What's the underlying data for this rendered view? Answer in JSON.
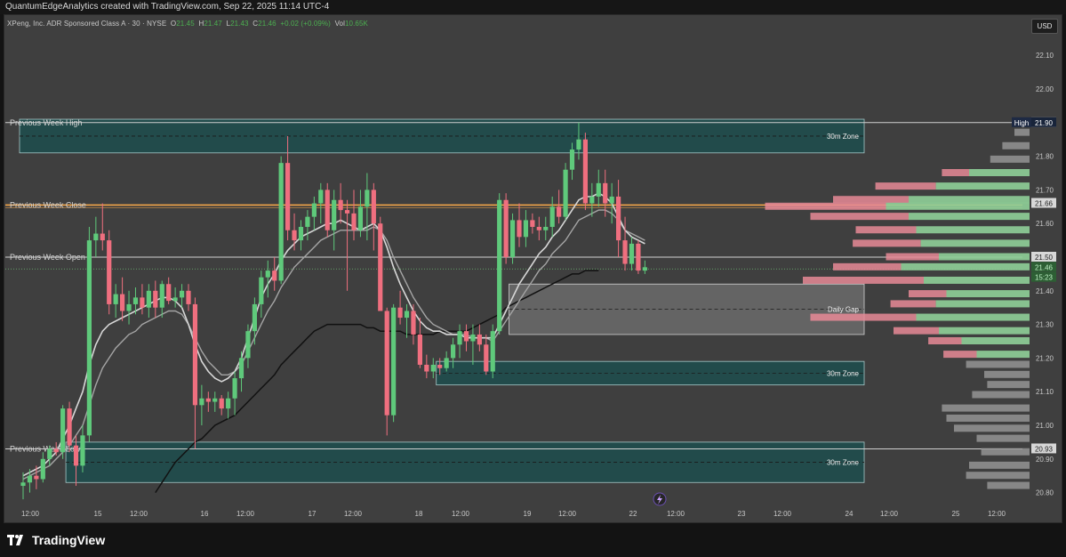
{
  "header": {
    "title": "QuantumEdgeAnalytics created with TradingView.com, Sep 22, 2025 11:14 UTC-4"
  },
  "legend": {
    "symbol": "XPeng, Inc. ADR Sponsored Class A · 30 · NYSE",
    "o_label": "O",
    "o": "21.45",
    "h_label": "H",
    "h": "21.47",
    "l_label": "L",
    "l": "21.43",
    "c_label": "C",
    "c": "21.46",
    "change": "+0.02 (+0.09%)",
    "vol_label": "Vol",
    "vol": "10.65K"
  },
  "currency_button": "USD",
  "footer": {
    "brand": "TradingView"
  },
  "colors": {
    "bull": "#5fc97b",
    "bear": "#ef6f7f",
    "zone": "#1f4d4d",
    "gap": "#6b6b6b",
    "close_line": "#f4a64a",
    "high_tag": "#1e2a44"
  },
  "chart_data": {
    "type": "candlestick",
    "timeframe": "30",
    "y_ticks": [
      "22.10",
      "22.00",
      "21.80",
      "21.70",
      "21.60",
      "21.40",
      "21.30",
      "21.20",
      "21.10",
      "21.00",
      "20.90",
      "20.80"
    ],
    "x_ticks": [
      "12:00",
      "15",
      "12:00",
      "16",
      "12:00",
      "17",
      "12:00",
      "18",
      "12:00",
      "19",
      "12:00",
      "22",
      "12:00",
      "23",
      "12:00",
      "24",
      "12:00",
      "25",
      "12:00"
    ],
    "candles": [
      [
        20.82,
        20.86,
        20.78,
        20.83
      ],
      [
        20.83,
        20.87,
        20.8,
        20.85
      ],
      [
        20.85,
        20.88,
        20.81,
        20.84
      ],
      [
        20.84,
        20.92,
        20.83,
        20.9
      ],
      [
        20.9,
        20.94,
        20.88,
        20.93
      ],
      [
        20.93,
        20.95,
        20.91,
        20.92
      ],
      [
        20.92,
        21.06,
        20.9,
        21.05
      ],
      [
        21.05,
        21.07,
        20.92,
        20.94
      ],
      [
        20.94,
        20.97,
        20.82,
        20.88
      ],
      [
        20.88,
        21.0,
        20.86,
        20.97
      ],
      [
        20.97,
        21.59,
        20.95,
        21.55
      ],
      [
        21.55,
        21.62,
        21.5,
        21.57
      ],
      [
        21.57,
        21.66,
        21.52,
        21.55
      ],
      [
        21.55,
        21.58,
        21.33,
        21.36
      ],
      [
        21.36,
        21.42,
        21.32,
        21.39
      ],
      [
        21.39,
        21.44,
        21.31,
        21.34
      ],
      [
        21.34,
        21.4,
        21.3,
        21.36
      ],
      [
        21.36,
        21.41,
        21.33,
        21.38
      ],
      [
        21.38,
        21.42,
        21.33,
        21.35
      ],
      [
        21.35,
        21.42,
        21.32,
        21.4
      ],
      [
        21.4,
        21.43,
        21.32,
        21.35
      ],
      [
        21.35,
        21.43,
        21.32,
        21.42
      ],
      [
        21.42,
        21.44,
        21.36,
        21.37
      ],
      [
        21.37,
        21.41,
        21.35,
        21.38
      ],
      [
        21.38,
        21.42,
        21.35,
        21.4
      ],
      [
        21.4,
        21.42,
        21.34,
        21.36
      ],
      [
        21.36,
        21.38,
        20.93,
        21.06
      ],
      [
        21.06,
        21.12,
        21.0,
        21.08
      ],
      [
        21.08,
        21.1,
        21.04,
        21.07
      ],
      [
        21.07,
        21.1,
        21.04,
        21.08
      ],
      [
        21.08,
        21.09,
        21.03,
        21.05
      ],
      [
        21.05,
        21.1,
        21.02,
        21.08
      ],
      [
        21.08,
        21.16,
        21.03,
        21.14
      ],
      [
        21.14,
        21.22,
        21.1,
        21.2
      ],
      [
        21.2,
        21.3,
        21.17,
        21.28
      ],
      [
        21.28,
        21.38,
        21.24,
        21.36
      ],
      [
        21.36,
        21.46,
        21.32,
        21.44
      ],
      [
        21.44,
        21.49,
        21.38,
        21.46
      ],
      [
        21.46,
        21.5,
        21.4,
        21.43
      ],
      [
        21.43,
        21.8,
        21.42,
        21.78
      ],
      [
        21.78,
        21.86,
        21.55,
        21.58
      ],
      [
        21.58,
        21.63,
        21.52,
        21.55
      ],
      [
        21.55,
        21.61,
        21.52,
        21.59
      ],
      [
        21.59,
        21.64,
        21.55,
        21.62
      ],
      [
        21.62,
        21.68,
        21.58,
        21.66
      ],
      [
        21.66,
        21.72,
        21.6,
        21.7
      ],
      [
        21.7,
        21.72,
        21.56,
        21.58
      ],
      [
        21.58,
        21.7,
        21.52,
        21.67
      ],
      [
        21.67,
        21.72,
        21.6,
        21.64
      ],
      [
        21.64,
        21.67,
        21.4,
        21.63
      ],
      [
        21.63,
        21.7,
        21.55,
        21.58
      ],
      [
        21.58,
        21.7,
        21.56,
        21.65
      ],
      [
        21.65,
        21.75,
        21.55,
        21.7
      ],
      [
        21.7,
        21.72,
        21.52,
        21.6
      ],
      [
        21.6,
        21.62,
        21.38,
        21.34
      ],
      [
        21.34,
        21.35,
        20.97,
        21.03
      ],
      [
        21.03,
        21.36,
        21.01,
        21.35
      ],
      [
        21.35,
        21.4,
        21.3,
        21.32
      ],
      [
        21.32,
        21.36,
        21.26,
        21.34
      ],
      [
        21.34,
        21.36,
        21.24,
        21.27
      ],
      [
        21.27,
        21.32,
        21.17,
        21.18
      ],
      [
        21.18,
        21.21,
        21.14,
        21.16
      ],
      [
        21.16,
        21.2,
        21.14,
        21.18
      ],
      [
        21.18,
        21.2,
        21.15,
        21.17
      ],
      [
        21.17,
        21.22,
        21.16,
        21.2
      ],
      [
        21.2,
        21.26,
        21.17,
        21.24
      ],
      [
        21.24,
        21.3,
        21.2,
        21.28
      ],
      [
        21.28,
        21.3,
        21.22,
        21.25
      ],
      [
        21.25,
        21.3,
        21.18,
        21.27
      ],
      [
        21.27,
        21.3,
        21.22,
        21.24
      ],
      [
        21.24,
        21.27,
        21.15,
        21.16
      ],
      [
        21.16,
        21.3,
        21.14,
        21.28
      ],
      [
        21.28,
        21.69,
        21.27,
        21.67
      ],
      [
        21.67,
        21.69,
        21.48,
        21.5
      ],
      [
        21.5,
        21.63,
        21.48,
        21.61
      ],
      [
        21.61,
        21.66,
        21.53,
        21.56
      ],
      [
        21.56,
        21.64,
        21.53,
        21.61
      ],
      [
        21.61,
        21.63,
        21.57,
        21.59
      ],
      [
        21.59,
        21.62,
        21.55,
        21.58
      ],
      [
        21.58,
        21.62,
        21.55,
        21.59
      ],
      [
        21.59,
        21.68,
        21.56,
        21.65
      ],
      [
        21.65,
        21.7,
        21.6,
        21.62
      ],
      [
        21.62,
        21.78,
        21.61,
        21.76
      ],
      [
        21.76,
        21.84,
        21.73,
        21.82
      ],
      [
        21.82,
        21.9,
        21.79,
        21.85
      ],
      [
        21.85,
        21.87,
        21.64,
        21.66
      ],
      [
        21.66,
        21.72,
        21.62,
        21.68
      ],
      [
        21.68,
        21.76,
        21.65,
        21.72
      ],
      [
        21.72,
        21.76,
        21.62,
        21.66
      ],
      [
        21.66,
        21.72,
        21.6,
        21.68
      ],
      [
        21.68,
        21.73,
        21.5,
        21.55
      ],
      [
        21.55,
        21.62,
        21.46,
        21.48
      ],
      [
        21.48,
        21.56,
        21.46,
        21.54
      ],
      [
        21.54,
        21.55,
        21.45,
        21.46
      ],
      [
        21.46,
        21.49,
        21.45,
        21.47
      ]
    ],
    "ema_fast": [
      20.85,
      20.86,
      20.87,
      20.88,
      20.9,
      20.92,
      20.96,
      21.0,
      21.05,
      21.1,
      21.18,
      21.24,
      21.28,
      21.3,
      21.31,
      21.32,
      21.33,
      21.34,
      21.35,
      21.36,
      21.37,
      21.38,
      21.38,
      21.37,
      21.35,
      21.3,
      21.24,
      21.19,
      21.16,
      21.14,
      21.13,
      21.14,
      21.16,
      21.2,
      21.26,
      21.32,
      21.38,
      21.42,
      21.45,
      21.49,
      21.52,
      21.54,
      21.56,
      21.57,
      21.58,
      21.59,
      21.6,
      21.6,
      21.61,
      21.6,
      21.59,
      21.58,
      21.59,
      21.6,
      21.58,
      21.53,
      21.47,
      21.42,
      21.38,
      21.34,
      21.31,
      21.29,
      21.28,
      21.28,
      21.27,
      21.27,
      21.27,
      21.26,
      21.26,
      21.26,
      21.26,
      21.26,
      21.3,
      21.34,
      21.38,
      21.42,
      21.45,
      21.48,
      21.51,
      21.53,
      21.56,
      21.58,
      21.61,
      21.64,
      21.67,
      21.68,
      21.68,
      21.69,
      21.68,
      21.66,
      21.62,
      21.58,
      21.56,
      21.55,
      21.54
    ],
    "ema_mid": [
      20.84,
      20.85,
      20.86,
      20.87,
      20.88,
      20.9,
      20.92,
      20.94,
      20.97,
      21.0,
      21.06,
      21.12,
      21.17,
      21.2,
      21.23,
      21.25,
      21.27,
      21.28,
      21.3,
      21.31,
      21.32,
      21.33,
      21.34,
      21.34,
      21.33,
      21.3,
      21.26,
      21.22,
      21.19,
      21.17,
      21.15,
      21.15,
      21.16,
      21.18,
      21.22,
      21.26,
      21.3,
      21.34,
      21.37,
      21.41,
      21.44,
      21.47,
      21.49,
      21.51,
      21.53,
      21.55,
      21.56,
      21.57,
      21.58,
      21.58,
      21.58,
      21.58,
      21.58,
      21.59,
      21.58,
      21.55,
      21.5,
      21.46,
      21.42,
      21.38,
      21.35,
      21.32,
      21.3,
      21.29,
      21.28,
      21.27,
      21.27,
      21.27,
      21.26,
      21.26,
      21.26,
      21.25,
      21.28,
      21.31,
      21.34,
      21.37,
      21.4,
      21.43,
      21.46,
      21.48,
      21.51,
      21.53,
      21.55,
      21.58,
      21.61,
      21.62,
      21.63,
      21.64,
      21.64,
      21.63,
      21.61,
      21.58,
      21.57,
      21.56,
      21.55
    ],
    "sma_slow": [
      null,
      null,
      null,
      null,
      null,
      null,
      null,
      null,
      null,
      null,
      null,
      null,
      null,
      null,
      null,
      null,
      null,
      null,
      null,
      null,
      20.8,
      20.83,
      20.86,
      20.89,
      20.91,
      20.93,
      20.95,
      20.96,
      20.98,
      21.0,
      21.01,
      21.02,
      21.03,
      21.05,
      21.07,
      21.09,
      21.11,
      21.13,
      21.15,
      21.18,
      21.2,
      21.22,
      21.24,
      21.26,
      21.28,
      21.29,
      21.3,
      21.3,
      21.3,
      21.3,
      21.3,
      21.3,
      21.29,
      21.29,
      21.28,
      21.28,
      21.28,
      21.28,
      21.27,
      21.27,
      21.27,
      21.27,
      21.27,
      21.28,
      21.28,
      21.28,
      21.28,
      21.28,
      21.29,
      21.3,
      21.31,
      21.32,
      21.33,
      21.35,
      21.36,
      21.37,
      21.38,
      21.39,
      21.4,
      21.41,
      21.42,
      21.43,
      21.44,
      21.45,
      21.45,
      21.46,
      21.46,
      21.46
    ],
    "levels": [
      {
        "name": "Previous Week High",
        "price": 21.9,
        "color": "#d0d0d0"
      },
      {
        "name": "Previous Week Close",
        "price": 21.655,
        "color": "#f4a64a"
      },
      {
        "name": "Previous Week Open",
        "price": 21.5,
        "color": "#d0d0d0"
      },
      {
        "name": "Previous Week Low",
        "price": 20.93,
        "color": "#d0d0d0"
      }
    ],
    "zones": [
      {
        "label": "30m Zone",
        "top": 21.91,
        "bottom": 21.81,
        "start": 0
      },
      {
        "label": "Daily Gap",
        "top": 21.42,
        "bottom": 21.27,
        "start": 74
      },
      {
        "label": "30m Zone",
        "top": 21.19,
        "bottom": 21.12,
        "start": 63
      },
      {
        "label": "30m Zone",
        "top": 20.95,
        "bottom": 20.83,
        "start": 7
      }
    ],
    "price_tags": [
      {
        "text": "21.90",
        "price": 21.9,
        "style": "light"
      },
      {
        "text": "21.66",
        "price": 21.66,
        "style": "light"
      },
      {
        "text": "21.50",
        "price": 21.5,
        "style": "light"
      },
      {
        "text": "21.46",
        "price": 21.47,
        "style": "green"
      },
      {
        "text": "15:23",
        "price": 21.44,
        "style": "green"
      },
      {
        "text": "20.93",
        "price": 20.93,
        "style": "light"
      }
    ],
    "high_tag": {
      "label": "High",
      "value": "21.90"
    },
    "volume_profile": [
      {
        "price": 21.87,
        "up": 0,
        "down": 0,
        "neutral": 10
      },
      {
        "price": 21.83,
        "up": 0,
        "down": 0,
        "neutral": 18
      },
      {
        "price": 21.79,
        "up": 0,
        "down": 0,
        "neutral": 26
      },
      {
        "price": 21.75,
        "up": 40,
        "down": 18,
        "neutral": 0
      },
      {
        "price": 21.71,
        "up": 62,
        "down": 40,
        "neutral": 0
      },
      {
        "price": 21.67,
        "up": 80,
        "down": 50,
        "neutral": 0
      },
      {
        "price": 21.65,
        "up": 95,
        "down": 80,
        "neutral": 0
      },
      {
        "price": 21.62,
        "up": 80,
        "down": 65,
        "neutral": 0
      },
      {
        "price": 21.58,
        "up": 75,
        "down": 40,
        "neutral": 0
      },
      {
        "price": 21.54,
        "up": 72,
        "down": 45,
        "neutral": 0
      },
      {
        "price": 21.5,
        "up": 60,
        "down": 35,
        "neutral": 0
      },
      {
        "price": 21.47,
        "up": 85,
        "down": 45,
        "neutral": 0
      },
      {
        "price": 21.43,
        "up": 70,
        "down": 80,
        "neutral": 0
      },
      {
        "price": 21.39,
        "up": 55,
        "down": 25,
        "neutral": 0
      },
      {
        "price": 21.36,
        "up": 62,
        "down": 30,
        "neutral": 0
      },
      {
        "price": 21.32,
        "up": 75,
        "down": 70,
        "neutral": 0
      },
      {
        "price": 21.28,
        "up": 60,
        "down": 30,
        "neutral": 0
      },
      {
        "price": 21.25,
        "up": 45,
        "down": 22,
        "neutral": 0
      },
      {
        "price": 21.21,
        "up": 35,
        "down": 22,
        "neutral": 0
      },
      {
        "price": 21.18,
        "up": 0,
        "down": 0,
        "neutral": 42
      },
      {
        "price": 21.15,
        "up": 0,
        "down": 0,
        "neutral": 30
      },
      {
        "price": 21.12,
        "up": 0,
        "down": 0,
        "neutral": 28
      },
      {
        "price": 21.09,
        "up": 0,
        "down": 0,
        "neutral": 38
      },
      {
        "price": 21.05,
        "up": 0,
        "down": 0,
        "neutral": 58
      },
      {
        "price": 21.02,
        "up": 0,
        "down": 0,
        "neutral": 55
      },
      {
        "price": 20.99,
        "up": 0,
        "down": 0,
        "neutral": 50
      },
      {
        "price": 20.96,
        "up": 0,
        "down": 0,
        "neutral": 35
      },
      {
        "price": 20.92,
        "up": 0,
        "down": 0,
        "neutral": 32
      },
      {
        "price": 20.88,
        "up": 0,
        "down": 0,
        "neutral": 40
      },
      {
        "price": 20.85,
        "up": 0,
        "down": 0,
        "neutral": 42
      },
      {
        "price": 20.82,
        "up": 0,
        "down": 0,
        "neutral": 28
      }
    ]
  }
}
